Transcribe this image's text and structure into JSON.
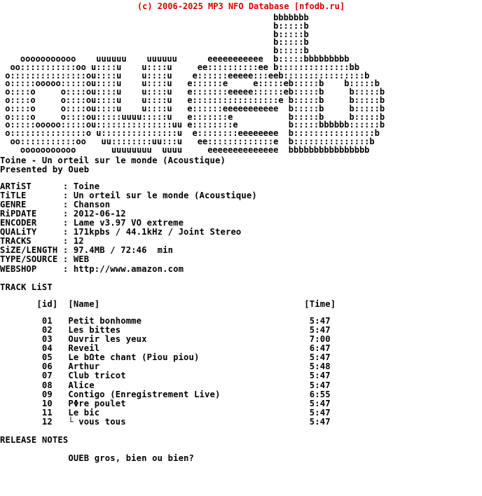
{
  "header": {
    "copyright": "(c) 2006-2025 MP3 NFO Database [nfodb.ru]",
    "color": "#e00000"
  },
  "logo": {
    "description": "ascii-art-oueb",
    "art": "                                                      bbbbbbb\n                                                      b:::::b\n                                                      b:::::b\n                                                      b:::::b\n                                                      b:::::b\n    ooooooooooo    uuuuuu    uuuuuu      eeeeeeeeeee  b:::::bbbbbbbbb\n  oo:::::::::::oo u::::u    u::::u     ee::::::::::ee b::::::::::::::bb\n o:::::::::::::::ou::::u    u::::u    e::::::eeeee:::eeb::::::::::::::::b\n o:::::ooooo:::::ou::::u    u::::u   e::::::e     e:::::eb:::::b    b:::::b\n o::::o     o::::ou::::u    u::::u   e:::::::eeeee::::::eb:::::b     b:::::b\n o::::o     o::::ou::::u    u::::u   e:::::::::::::::::e b:::::b     b:::::b\n o::::o     o::::ou::::u    u::::u   e::::::eeeeeeeeeee  b:::::b     b:::::b\n o::::o     o::::ou:::::uuuu:::::u   e:::::::e           b:::::b     b:::::b\n o:::::ooooo:::::ou:::::::::::::::uu e::::::::e          b:::::bbbbbb::::::b\n o:::::::::::::::o u:::::::::::::::u  e::::::::eeeeeeee  b::::::::::::::::b\n  oo:::::::::::oo   uu::::::::uu:::u   ee:::::::::::::e  b:::::::::::::::b\n    ooooooooooo       uuuuuuuu  uuuu     eeeeeeeeeeeeee  bbbbbbbbbbbbbbbb"
  },
  "title": "Toine - Un orteil sur le monde (Acoustique)",
  "presented_by": "Presented by Oueb",
  "info": {
    "labels": [
      "ARTiST",
      "TiTLE",
      "GENRE",
      "RiPDATE",
      "ENCODER",
      "QUALiTY",
      "TRACKS",
      "SiZE/LENGTH",
      "TYPE/SOURCE",
      "WEBSHOP"
    ],
    "values": [
      "Toine",
      "Un orteil sur le monde (Acoustique)",
      "Chanson",
      "2012-06-12",
      "Lame v3.97 VO extreme",
      "171kpbs / 44.1kHz / Joint Stereo",
      "12",
      "97.4MB / 72:46  min",
      "WEB",
      "http://www.amazon.com"
    ]
  },
  "tracklist": {
    "section_title": "TRACK LiST",
    "col_id": "[id]",
    "col_name": "[Name]",
    "col_time": "[Time]",
    "tracks": [
      {
        "id": "01",
        "name": "Petit bonhomme",
        "time": "5:47"
      },
      {
        "id": "02",
        "name": "Les bittes",
        "time": "5:47"
      },
      {
        "id": "03",
        "name": "Ouvrir les yeux",
        "time": "7:00"
      },
      {
        "id": "04",
        "name": "Reveil",
        "time": "6:47"
      },
      {
        "id": "05",
        "name": "Le bΩte chant (Piou piou)",
        "time": "5:47"
      },
      {
        "id": "06",
        "name": "Arthur",
        "time": "5:48"
      },
      {
        "id": "07",
        "name": "Club tricot",
        "time": "5:47"
      },
      {
        "id": "08",
        "name": "Alice",
        "time": "5:47"
      },
      {
        "id": "09",
        "name": "Contigo (Enregistrement Live)",
        "time": "6:55"
      },
      {
        "id": "10",
        "name": "PΦre poulet",
        "time": "5:47"
      },
      {
        "id": "11",
        "name": "Le bic",
        "time": "5:47"
      },
      {
        "id": "12",
        "name": "└ vous tous",
        "time": "5:47"
      }
    ]
  },
  "release_notes": {
    "section_title": "RELEASE NOTES",
    "body": "OUEB gros, bien ou bien?"
  }
}
